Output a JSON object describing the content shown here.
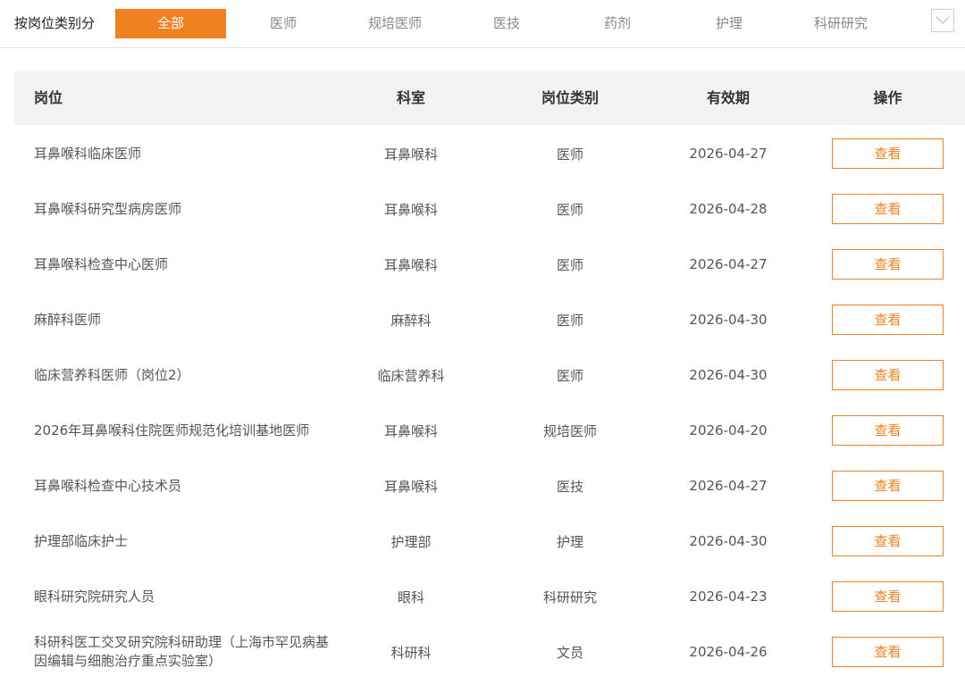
{
  "filter": {
    "label": "按岗位类别分",
    "tabs": [
      "全部",
      "医师",
      "规培医师",
      "医技",
      "药剂",
      "护理",
      "科研研究"
    ],
    "active_index": 0,
    "accent_color": "#f0811f",
    "expand_icon": "chevron-down-icon"
  },
  "table": {
    "headers": {
      "title": "岗位",
      "dept": "科室",
      "category": "岗位类别",
      "expiry": "有效期",
      "action": "操作"
    },
    "rows": [
      {
        "title": "耳鼻喉科临床医师",
        "dept": "耳鼻喉科",
        "category": "医师",
        "expiry": "2026-04-27",
        "action": "查看"
      },
      {
        "title": "耳鼻喉科研究型病房医师",
        "dept": "耳鼻喉科",
        "category": "医师",
        "expiry": "2026-04-28",
        "action": "查看"
      },
      {
        "title": "耳鼻喉科检查中心医师",
        "dept": "耳鼻喉科",
        "category": "医师",
        "expiry": "2026-04-27",
        "action": "查看"
      },
      {
        "title": "麻醉科医师",
        "dept": "麻醉科",
        "category": "医师",
        "expiry": "2026-04-30",
        "action": "查看"
      },
      {
        "title": "临床营养科医师（岗位2）",
        "dept": "临床营养科",
        "category": "医师",
        "expiry": "2026-04-30",
        "action": "查看"
      },
      {
        "title": "2026年耳鼻喉科住院医师规范化培训基地医师",
        "dept": "耳鼻喉科",
        "category": "规培医师",
        "expiry": "2026-04-20",
        "action": "查看"
      },
      {
        "title": "耳鼻喉科检查中心技术员",
        "dept": "耳鼻喉科",
        "category": "医技",
        "expiry": "2026-04-27",
        "action": "查看"
      },
      {
        "title": "护理部临床护士",
        "dept": "护理部",
        "category": "护理",
        "expiry": "2026-04-30",
        "action": "查看"
      },
      {
        "title": "眼科研究院研究人员",
        "dept": "眼科",
        "category": "科研研究",
        "expiry": "2026-04-23",
        "action": "查看"
      },
      {
        "title": "科研科医工交叉研究院科研助理（上海市罕见病基因编辑与细胞治疗重点实验室）",
        "dept": "科研科",
        "category": "文员",
        "expiry": "2026-04-26",
        "action": "查看"
      }
    ]
  }
}
